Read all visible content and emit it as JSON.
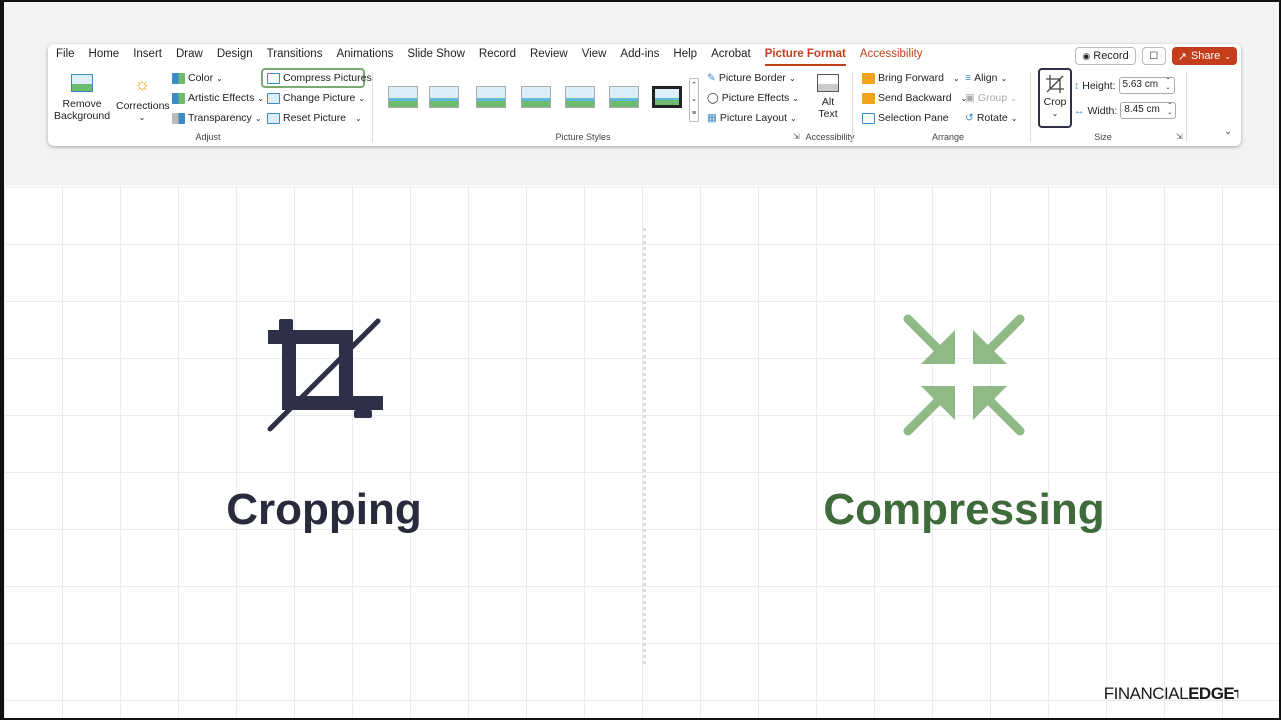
{
  "ribbon": {
    "tabs": [
      "File",
      "Home",
      "Insert",
      "Draw",
      "Design",
      "Transitions",
      "Animations",
      "Slide Show",
      "Record",
      "Review",
      "View",
      "Add-ins",
      "Help",
      "Acrobat",
      "Picture Format",
      "Accessibility"
    ],
    "active_tab": "Picture Format",
    "record_label": "Record",
    "share_label": "Share",
    "adjust": {
      "remove_background": [
        "Remove",
        "Background"
      ],
      "corrections": "Corrections",
      "color": "Color",
      "artistic_effects": "Artistic Effects",
      "transparency": "Transparency",
      "compress_pictures": "Compress Pictures",
      "change_picture": "Change Picture",
      "reset_picture": "Reset Picture",
      "group_label": "Adjust"
    },
    "picture_styles": {
      "picture_border": "Picture Border",
      "picture_effects": "Picture Effects",
      "picture_layout": "Picture Layout",
      "group_label": "Picture Styles"
    },
    "accessibility": {
      "alt_text": [
        "Alt",
        "Text"
      ],
      "group_label": "Accessibility"
    },
    "arrange": {
      "bring_forward": "Bring Forward",
      "send_backward": "Send Backward",
      "selection_pane": "Selection Pane",
      "align": "Align",
      "group": "Group",
      "rotate": "Rotate",
      "group_label": "Arrange"
    },
    "size": {
      "crop": "Crop",
      "height_label": "Height:",
      "height_value": "5.63 cm",
      "width_label": "Width:",
      "width_value": "8.45 cm",
      "group_label": "Size"
    }
  },
  "slide": {
    "left_title": "Cropping",
    "right_title": "Compressing",
    "logo_light": "FINANCIAL",
    "logo_bold": "EDGE"
  },
  "colors": {
    "accent_red": "#c43e1c",
    "crop_icon": "#2e3047",
    "compress_icon": "#8fb985",
    "compress_title": "#3f6a3a",
    "highlight_green": "#7aab72"
  }
}
